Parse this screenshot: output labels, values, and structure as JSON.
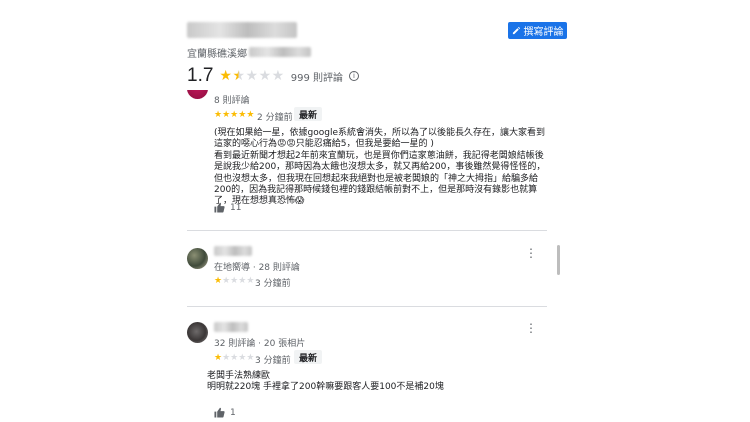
{
  "place": {
    "address": "宜蘭縣礁溪鄉",
    "rating": "1.7",
    "rating_stars": 1.7,
    "review_count": "999 則評論",
    "write_review_label": "撰寫評論"
  },
  "reviews": [
    {
      "meta": "8 則評論",
      "stars": 5,
      "time": "2 分鐘前",
      "badge": "最新",
      "text": [
        "(現在如果給一星，依據google系統會消失，所以為了以後能長久存在，讓大家看到這家的噁心行為😡😡只能忍痛給5，但我是要給一星的 )",
        "看到最近新聞才想起2年前來宜蘭玩，也是買你們這家蔥油餅，我記得老闆娘結帳後是說我少給200，那時因為太餓也沒想太多，就又再給200，事後雖然覺得怪怪的，但也沒想太多，但我現在回想起來我絕對也是被老闆娘的「神之大拇指」給騙多給200的，因為我記得那時候錢包裡的錢跟結帳前對不上，但是那時沒有錄影也就算了，現在想想真恐怖😱"
      ],
      "likes": "11"
    },
    {
      "meta": "在地嚮導 · 28 則評論",
      "stars": 1,
      "time": "3 分鐘前",
      "badge": ""
    },
    {
      "meta": "32 則評論 · 20 張相片",
      "stars": 1,
      "time": "3 分鐘前",
      "badge": "最新",
      "text": [
        "老闆手法熟練歐",
        "明明就220塊 手裡拿了200幹嘛要跟客人要100不是補20塊"
      ],
      "likes": "1"
    }
  ],
  "icons": {
    "edit": "edit-pencil-icon",
    "info": "info-icon",
    "more": "more-vertical-icon",
    "like": "thumb-up-icon"
  },
  "colors": {
    "accent": "#1a73e8",
    "star": "#fbbc04",
    "star_empty": "#dadce0"
  }
}
